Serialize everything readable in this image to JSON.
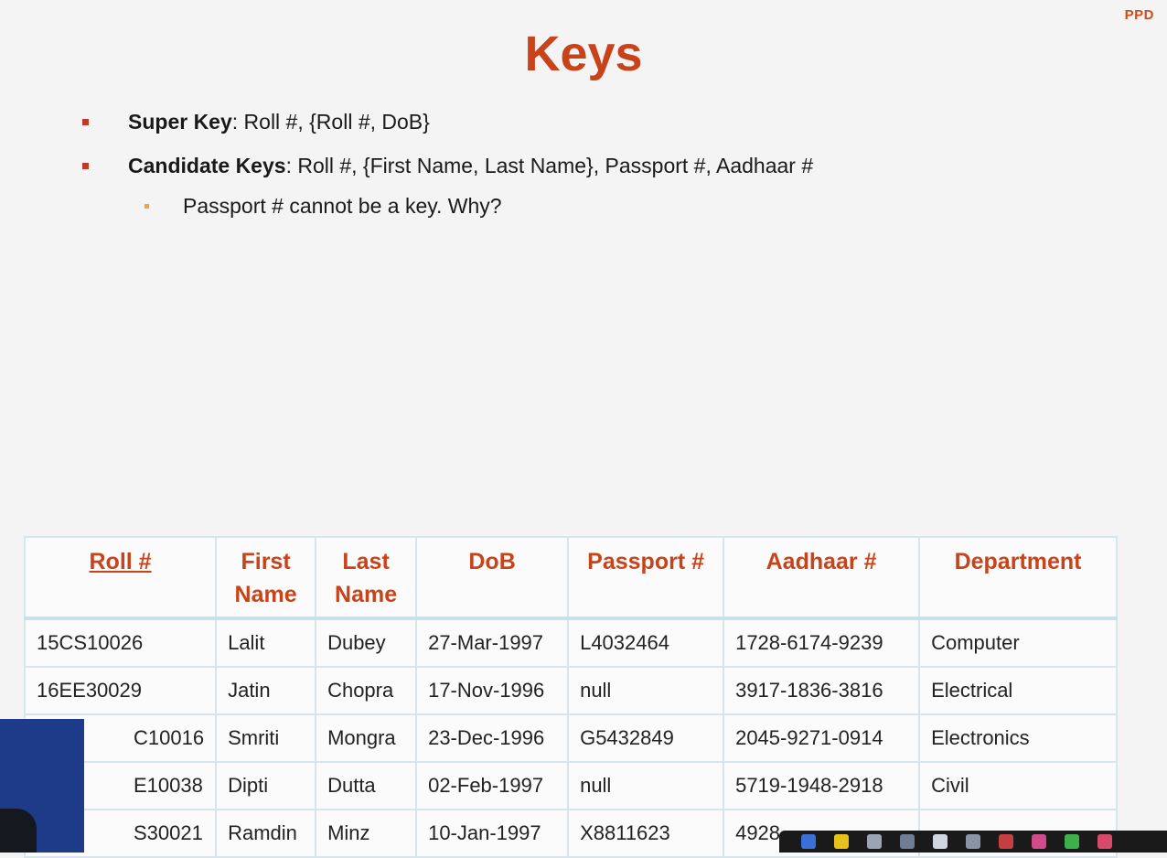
{
  "logo_text": "PPD",
  "title": "Keys",
  "bullets": {
    "super_key": {
      "label": "Super Key",
      "text": ": Roll #, {Roll #, DoB}"
    },
    "candidate_keys": {
      "label": "Candidate Keys",
      "text": ": Roll #, {First Name, Last Name}, Passport #, Aadhaar #"
    },
    "sub": "Passport # cannot be a key. Why?"
  },
  "table": {
    "headers": {
      "roll": "Roll #",
      "first_1": "First",
      "first_2": "Name",
      "last_1": "Last",
      "last_2": "Name",
      "dob": "DoB",
      "passport": "Passport #",
      "aadhaar": "Aadhaar #",
      "department": "Department"
    },
    "rows": [
      [
        "15CS10026",
        "Lalit",
        "Dubey",
        "27-Mar-1997",
        "L4032464",
        "1728-6174-9239",
        "Computer"
      ],
      [
        "16EE30029",
        "Jatin",
        "Chopra",
        "17-Nov-1996",
        "null",
        "3917-1836-3816",
        "Electrical"
      ],
      [
        "C10016",
        "Smriti",
        "Mongra",
        "23-Dec-1996",
        "G5432849",
        "2045-9271-0914",
        "Electronics"
      ],
      [
        "E10038",
        "Dipti",
        "Dutta",
        "02-Feb-1997",
        "null",
        "5719-1948-2918",
        "Civil"
      ],
      [
        "S30021",
        "Ramdin",
        "Minz",
        "10-Jan-1997",
        "X8811623",
        "4928",
        ""
      ]
    ]
  },
  "toolbar_colors": [
    "#3a6fd8",
    "#e8c21a",
    "#9aa4b4",
    "#6e7c96",
    "#cfd6e2",
    "#8a94a8",
    "#c44040",
    "#d24a8c",
    "#3cb04a",
    "#d84a6a"
  ]
}
